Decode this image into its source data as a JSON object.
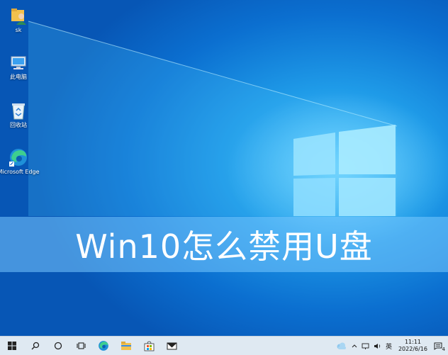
{
  "desktop": {
    "icons": [
      {
        "label": "sk",
        "icon": "user-folder-icon"
      },
      {
        "label": "此电脑",
        "icon": "computer-icon"
      },
      {
        "label": "回收站",
        "icon": "recycle-bin-icon"
      },
      {
        "label": "Microsoft Edge",
        "icon": "edge-icon"
      }
    ]
  },
  "banner": {
    "title": "Win10怎么禁用U盘"
  },
  "taskbar": {
    "apps": [
      "start-icon",
      "search-icon",
      "cortana-icon",
      "task-view-icon",
      "edge-icon",
      "file-explorer-icon",
      "store-icon",
      "mail-icon"
    ],
    "tray": {
      "ime": "英",
      "time": "11:11",
      "date": "2022/6/16",
      "notification_count": "4"
    }
  }
}
